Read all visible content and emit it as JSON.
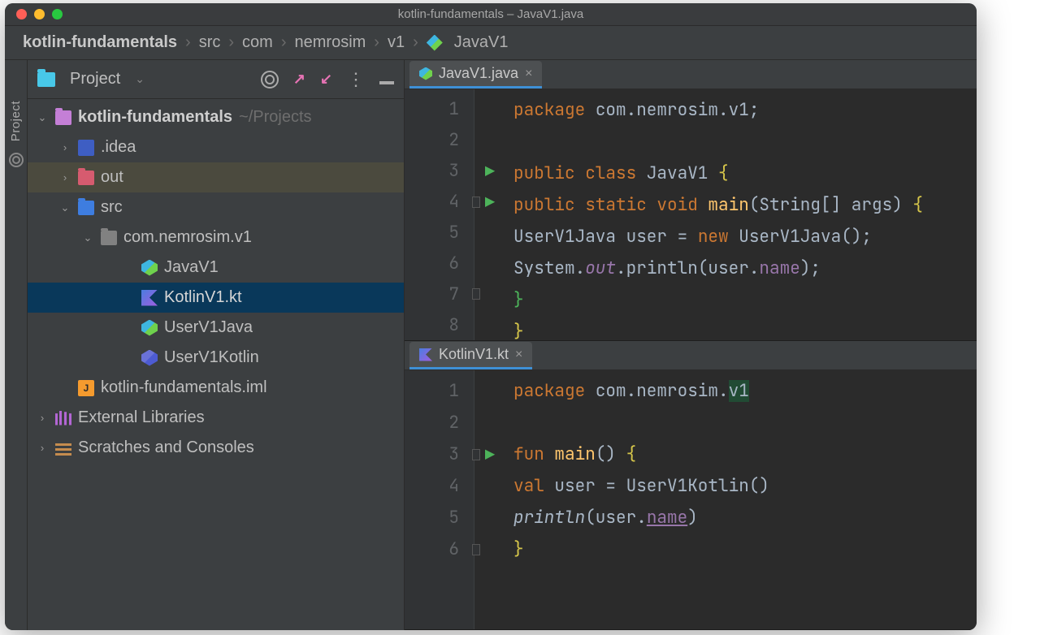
{
  "window": {
    "title": "kotlin-fundamentals – JavaV1.java"
  },
  "breadcrumb": {
    "root": "kotlin-fundamentals",
    "parts": [
      "src",
      "com",
      "nemrosim",
      "v1"
    ],
    "file": "JavaV1"
  },
  "sidebar": {
    "label": "Project"
  },
  "projectHeader": {
    "title": "Project"
  },
  "tree": {
    "root": {
      "name": "kotlin-fundamentals",
      "path": "~/Projects"
    },
    "idea": ".idea",
    "out": "out",
    "src": "src",
    "pkg": "com.nemrosim.v1",
    "files": {
      "javaV1": "JavaV1",
      "kotlinV1": "KotlinV1.kt",
      "userJava": "UserV1Java",
      "userKotlin": "UserV1Kotlin"
    },
    "iml": "kotlin-fundamentals.iml",
    "ext": "External Libraries",
    "scratch": "Scratches and Consoles"
  },
  "tabs": {
    "top": "JavaV1.java",
    "bot": "KotlinV1.kt"
  },
  "code": {
    "java": {
      "l1a": "package ",
      "l1b": "com.nemrosim.v1",
      "l1c": ";",
      "l3a": "public class ",
      "l3b": "JavaV1 ",
      "l3c": "{",
      "l4a": "public static void ",
      "l4b": "main",
      "l4c": "(String[] args) ",
      "l4d": "{",
      "l5a": "UserV1Java user = ",
      "l5b": "new ",
      "l5c": "UserV1Java();",
      "l6a": "System.",
      "l6b": "out",
      "l6c": ".println(user.",
      "l6d": "name",
      "l6e": ");",
      "l7": "}",
      "l8": "}"
    },
    "kt": {
      "l1a": "package ",
      "l1b": "com.nemrosim.",
      "l1c": "v1",
      "l3a": "fun ",
      "l3b": "main",
      "l3c": "() ",
      "l3d": "{",
      "l4a": "val ",
      "l4b": "user = UserV1Kotlin()",
      "l5a": "println",
      "l5b": "(user.",
      "l5c": "name",
      "l5d": ")",
      "l6": "}"
    }
  }
}
